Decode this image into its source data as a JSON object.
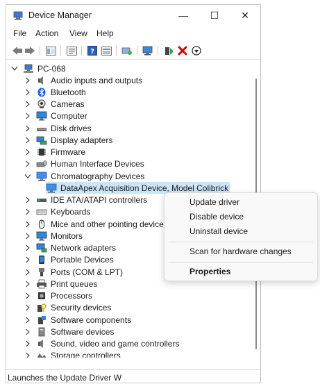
{
  "window": {
    "title": "Device Manager",
    "minimize": "—",
    "maximize": "☐",
    "close": "✕"
  },
  "menu": [
    "File",
    "Action",
    "View",
    "Help"
  ],
  "tree": {
    "root": "PC-068",
    "items": [
      {
        "label": "Audio inputs and outputs",
        "icon": "speaker-icon",
        "state": "collapsed"
      },
      {
        "label": "Bluetooth",
        "icon": "bluetooth-icon",
        "state": "collapsed"
      },
      {
        "label": "Cameras",
        "icon": "camera-icon",
        "state": "collapsed"
      },
      {
        "label": "Computer",
        "icon": "monitor-icon",
        "state": "collapsed"
      },
      {
        "label": "Disk drives",
        "icon": "disk-icon",
        "state": "collapsed"
      },
      {
        "label": "Display adapters",
        "icon": "display-adapter-icon",
        "state": "collapsed"
      },
      {
        "label": "Firmware",
        "icon": "firmware-icon",
        "state": "collapsed"
      },
      {
        "label": "Human Interface Devices",
        "icon": "hid-icon",
        "state": "collapsed"
      },
      {
        "label": "Chromatography Devices",
        "icon": "device-icon",
        "state": "expanded"
      },
      {
        "label": "DataApex Acquisition Device, Model Colibrick",
        "icon": "device-icon",
        "state": "child"
      },
      {
        "label": "IDE ATA/ATAPI controllers",
        "icon": "ide-icon",
        "state": "collapsed"
      },
      {
        "label": "Keyboards",
        "icon": "keyboard-icon",
        "state": "collapsed"
      },
      {
        "label": "Mice and other pointing devices",
        "icon": "mouse-icon",
        "state": "collapsed"
      },
      {
        "label": "Monitors",
        "icon": "monitor-icon",
        "state": "collapsed"
      },
      {
        "label": "Network adapters",
        "icon": "network-icon",
        "state": "collapsed"
      },
      {
        "label": "Portable Devices",
        "icon": "portable-icon",
        "state": "collapsed"
      },
      {
        "label": "Ports (COM & LPT)",
        "icon": "port-icon",
        "state": "collapsed"
      },
      {
        "label": "Print queues",
        "icon": "printer-icon",
        "state": "collapsed"
      },
      {
        "label": "Processors",
        "icon": "processor-icon",
        "state": "collapsed"
      },
      {
        "label": "Security devices",
        "icon": "security-icon",
        "state": "collapsed"
      },
      {
        "label": "Software components",
        "icon": "software-component-icon",
        "state": "collapsed"
      },
      {
        "label": "Software devices",
        "icon": "software-device-icon",
        "state": "collapsed"
      },
      {
        "label": "Sound, video and game controllers",
        "icon": "speaker-icon",
        "state": "collapsed"
      },
      {
        "label": "Storage controllers",
        "icon": "storage-icon",
        "state": "collapsed"
      }
    ]
  },
  "context_menu": {
    "update": "Update driver",
    "disable": "Disable device",
    "uninstall": "Uninstall device",
    "scan": "Scan for hardware changes",
    "properties": "Properties"
  },
  "status": "Launches the Update Driver W",
  "colors": {
    "selection": "#cce4f7",
    "accent": "#0078d4",
    "delete_red": "#d40000"
  }
}
